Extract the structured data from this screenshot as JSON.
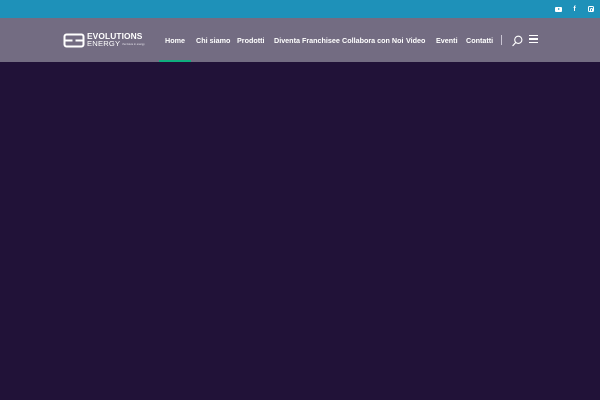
{
  "topbar": {
    "background": "#1e91b9",
    "social_icons": [
      "youtube-icon",
      "facebook-icon",
      "instagram-icon"
    ]
  },
  "navbar": {
    "background": "#736c82",
    "logo": {
      "line1": "EVOLUTIONS",
      "line2": "ENERGY",
      "tagline": "the future in energy"
    },
    "menu": [
      {
        "label": "Home",
        "active": true
      },
      {
        "label": "Chi siamo"
      },
      {
        "label": "Prodotti"
      },
      {
        "label": "Diventa Franchisee"
      },
      {
        "label": "Collabora con Noi"
      },
      {
        "label": "Video"
      },
      {
        "label": "Eventi"
      },
      {
        "label": "Contatti"
      }
    ],
    "active_indicator_color": "#0fae7e",
    "tools": [
      "search-icon",
      "menu-icon"
    ]
  },
  "hero": {
    "background": "#211238"
  }
}
